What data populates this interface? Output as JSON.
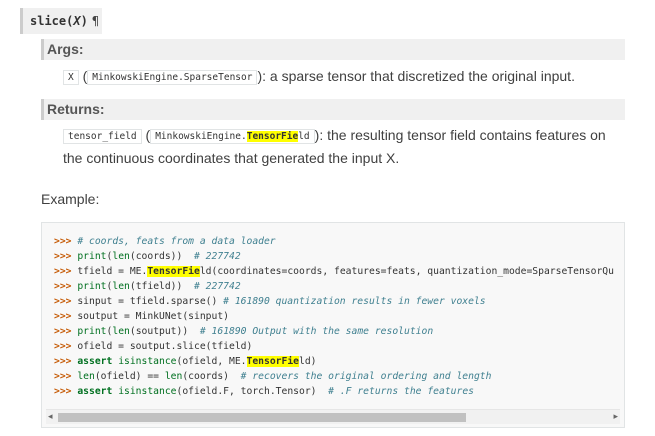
{
  "signature": {
    "func": "slice",
    "arg": "X",
    "link_glyph": "¶"
  },
  "args": {
    "heading": "Args:",
    "param": "X",
    "type": "MinkowskiEngine.SparseTensor",
    "description": ": a sparse tensor that discretized the original input."
  },
  "returns": {
    "heading": "Returns:",
    "name": "tensor_field",
    "type_prefix": "MinkowskiEngine.",
    "type_highlight": "TensorFie",
    "type_suffix": "ld",
    "description_line1": ": the resulting tensor field contains features on",
    "description_line2": "the continuous coordinates that generated the input X."
  },
  "example": {
    "label": "Example:",
    "code": [
      [
        [
          "p",
          ">>> "
        ],
        [
          "c",
          "# coords, feats from a data loader"
        ]
      ],
      [
        [
          "p",
          ">>> "
        ],
        [
          "b",
          "print"
        ],
        [
          "t",
          "("
        ],
        [
          "b",
          "len"
        ],
        [
          "t",
          "(coords))  "
        ],
        [
          "c",
          "# 227742"
        ]
      ],
      [
        [
          "p",
          ">>> "
        ],
        [
          "t",
          "tfield = ME."
        ],
        [
          "h",
          "TensorFie"
        ],
        [
          "t",
          "ld(coordinates=coords, features=feats, quantization_mode=SparseTensorQu"
        ]
      ],
      [
        [
          "p",
          ">>> "
        ],
        [
          "b",
          "print"
        ],
        [
          "t",
          "("
        ],
        [
          "b",
          "len"
        ],
        [
          "t",
          "(tfield))  "
        ],
        [
          "c",
          "# 227742"
        ]
      ],
      [
        [
          "p",
          ">>> "
        ],
        [
          "t",
          "sinput = tfield.sparse() "
        ],
        [
          "c",
          "# 161890 quantization results in fewer voxels"
        ]
      ],
      [
        [
          "p",
          ">>> "
        ],
        [
          "t",
          "soutput = MinkUNet(sinput)"
        ]
      ],
      [
        [
          "p",
          ">>> "
        ],
        [
          "b",
          "print"
        ],
        [
          "t",
          "("
        ],
        [
          "b",
          "len"
        ],
        [
          "t",
          "(soutput))  "
        ],
        [
          "c",
          "# 161890 Output with the same resolution"
        ]
      ],
      [
        [
          "p",
          ">>> "
        ],
        [
          "t",
          "ofield = soutput.slice(tfield)"
        ]
      ],
      [
        [
          "p",
          ">>> "
        ],
        [
          "k",
          "assert"
        ],
        [
          "t",
          " "
        ],
        [
          "b",
          "isinstance"
        ],
        [
          "t",
          "(ofield, ME."
        ],
        [
          "h",
          "TensorFie"
        ],
        [
          "t",
          "ld)"
        ]
      ],
      [
        [
          "p",
          ">>> "
        ],
        [
          "b",
          "len"
        ],
        [
          "t",
          "(ofield) == "
        ],
        [
          "b",
          "len"
        ],
        [
          "t",
          "(coords)  "
        ],
        [
          "c",
          "# recovers the original ordering and length"
        ]
      ],
      [
        [
          "p",
          ">>> "
        ],
        [
          "k",
          "assert"
        ],
        [
          "t",
          " "
        ],
        [
          "b",
          "isinstance"
        ],
        [
          "t",
          "(ofield.F, torch.Tensor)  "
        ],
        [
          "c",
          "# .F returns the features"
        ]
      ]
    ]
  },
  "scrollbar": {
    "left_arrow": "◂",
    "right_arrow": "▸"
  }
}
